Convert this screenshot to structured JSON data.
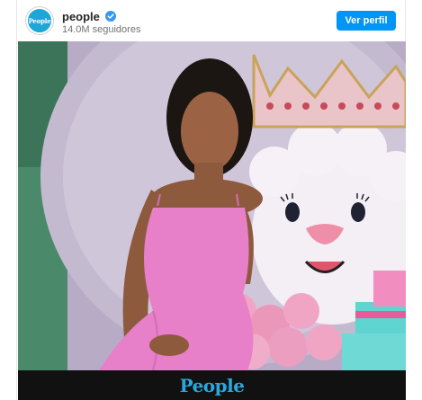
{
  "header": {
    "account_name": "people",
    "followers": "14.0M seguidores",
    "view_profile_label": "Ver perfil",
    "avatar_text": "People"
  },
  "media": {
    "watermark": "People"
  },
  "colors": {
    "brand_blue": "#29a8e0",
    "button_blue": "#0095f6",
    "verified_blue": "#3897f0",
    "dress_pink": "#e77fc9"
  },
  "icons": [
    "verified-badge-icon"
  ]
}
